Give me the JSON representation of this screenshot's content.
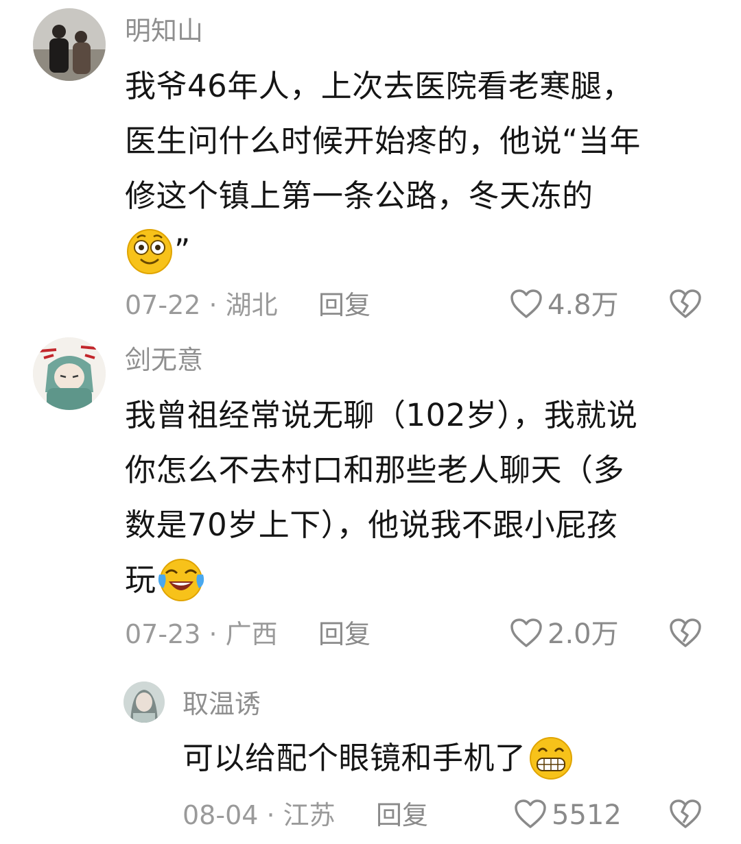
{
  "comments": [
    {
      "username": "明知山",
      "avatar_icon": "couple-photo-avatar",
      "lines": [
        "我爷46年人，上次去医院看老寒腿，",
        "医生问什么时候开始疼的，他说“当年",
        "修这个镇上第一条公路，冬天冻的"
      ],
      "last_line_suffix": "”",
      "emoji": "flushed-face-icon",
      "date": "07-22",
      "location": "湖北",
      "reply_label": "回复",
      "likes": "4.8万"
    },
    {
      "username": "剑无意",
      "avatar_icon": "anime-character-avatar",
      "lines": [
        "我曾祖经常说无聊（102岁），我就说",
        "你怎么不去村口和那些老人聊天（多",
        "数是70岁上下），他说我不跟小屁孩"
      ],
      "last_line_text": "玩",
      "emoji": "crying-laughing-icon",
      "date": "07-23",
      "location": "广西",
      "reply_label": "回复",
      "likes": "2.0万"
    },
    {
      "username": "取温诱",
      "avatar_icon": "girl-photo-avatar",
      "lines": [
        "可以给配个眼镜和手机了"
      ],
      "emoji": "grinning-face-icon",
      "date": "08-04",
      "location": "江苏",
      "reply_label": "回复",
      "likes": "5512"
    }
  ],
  "separator": " · ",
  "colors": {
    "username": "#8f8f8f",
    "body_text": "#151515",
    "meta": "#9a9a9a",
    "emoji_yellow": "#f7c21a"
  }
}
